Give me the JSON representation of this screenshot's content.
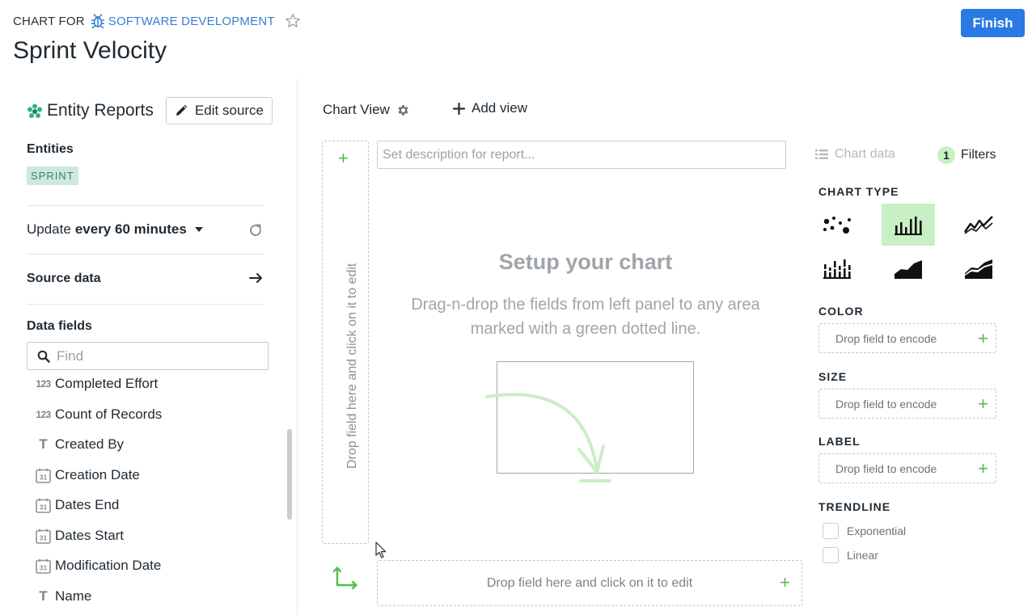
{
  "header": {
    "crumb_prefix": "CHART FOR",
    "project_name": "SOFTWARE DEVELOPMENT",
    "title": "Sprint Velocity",
    "finish_label": "Finish"
  },
  "source": {
    "name": "Entity Reports",
    "edit_label": "Edit source",
    "entities_label": "Entities",
    "entity_badge": "SPRINT",
    "update_prefix": "Update",
    "update_value": "every 60 minutes",
    "source_data_label": "Source data",
    "data_fields_label": "Data fields",
    "find_placeholder": "Find"
  },
  "fields": [
    {
      "type": "number",
      "icon_text": "123",
      "label": "Completed Effort"
    },
    {
      "type": "number",
      "icon_text": "123",
      "label": "Count of Records"
    },
    {
      "type": "text",
      "icon_text": "T",
      "label": "Created By"
    },
    {
      "type": "date",
      "icon_text": "31",
      "label": "Creation Date"
    },
    {
      "type": "date",
      "icon_text": "31",
      "label": "Dates End"
    },
    {
      "type": "date",
      "icon_text": "31",
      "label": "Dates Start"
    },
    {
      "type": "date",
      "icon_text": "31",
      "label": "Modification Date"
    },
    {
      "type": "text",
      "icon_text": "T",
      "label": "Name"
    }
  ],
  "views": {
    "chart_view_label": "Chart View",
    "add_view_label": "Add view"
  },
  "canvas": {
    "description_placeholder": "Set description for report...",
    "setup_title": "Setup your chart",
    "setup_text": "Drag-n-drop the fields from left panel to any area marked with a green dotted line.",
    "y_drop_text": "Drop field here and click on it to edit",
    "x_drop_text": "Drop field here and click on it to edit"
  },
  "panel": {
    "chart_data_label": "Chart data",
    "filters_count": "1",
    "filters_label": "Filters",
    "chart_type_label": "CHART TYPE",
    "chart_types": [
      "scatter",
      "bar",
      "line",
      "stacked-bar",
      "area",
      "stacked-area"
    ],
    "selected_chart_type": "bar",
    "color_label": "COLOR",
    "size_label": "SIZE",
    "label_label": "LABEL",
    "drop_encode_text": "Drop field to encode",
    "trendline_label": "TRENDLINE",
    "trend_exponential": "Exponential",
    "trend_linear": "Linear"
  },
  "colors": {
    "accent": "#2a7ae4",
    "green": "#4fbf48",
    "green_dash": "#a8dca2",
    "selected_bg": "#c9efc4",
    "badge_bg": "#cde8e1"
  }
}
